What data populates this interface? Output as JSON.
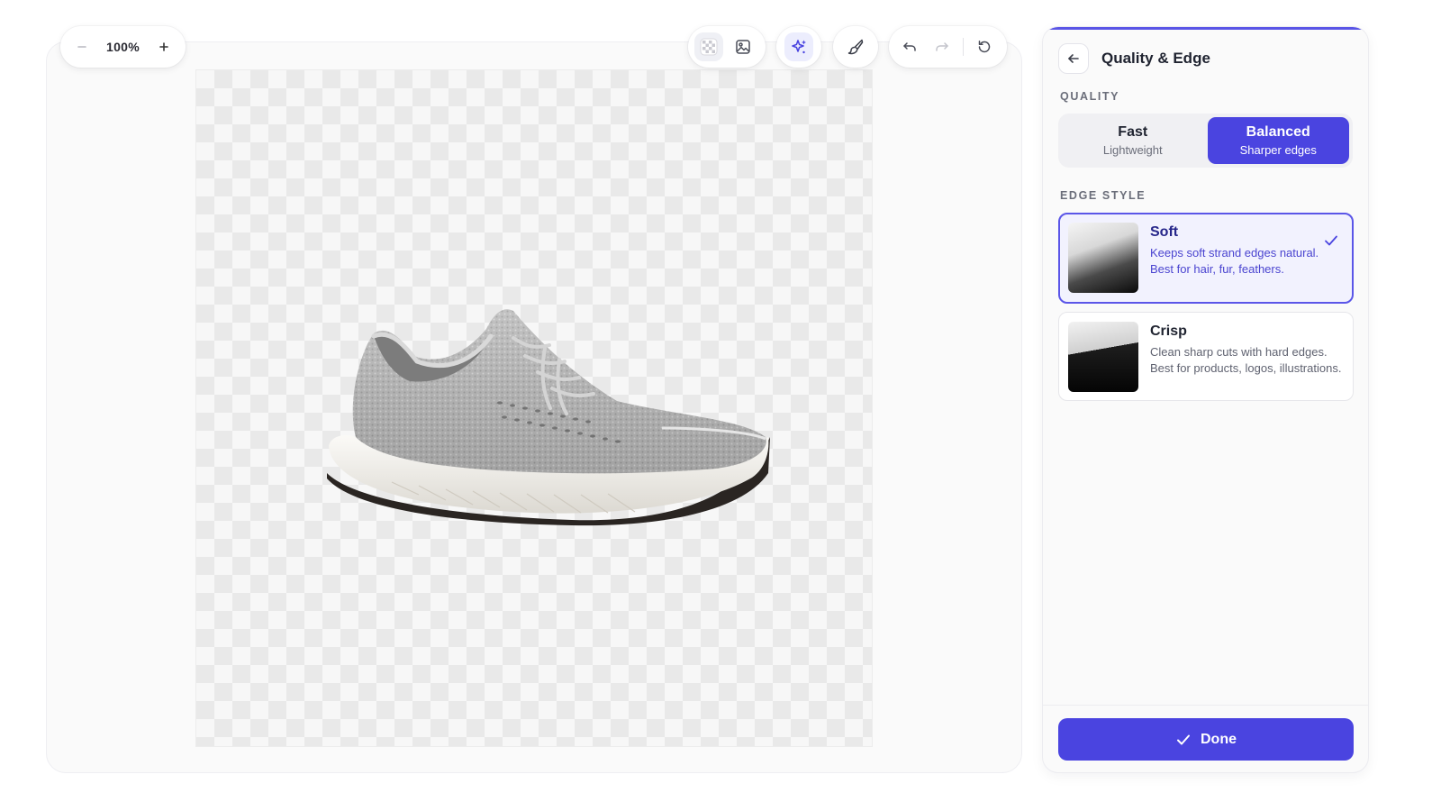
{
  "zoom": {
    "minus_icon": "minus-icon",
    "value": "100%",
    "plus_icon": "plus-icon"
  },
  "toolbar": {
    "icons": [
      "transparent-bg-icon",
      "image-bg-icon",
      "sparkle-icon",
      "brush-icon",
      "undo-icon",
      "redo-icon",
      "reset-icon"
    ]
  },
  "panel": {
    "title": "Quality & Edge",
    "quality_label": "QUALITY",
    "quality_options": [
      {
        "title": "Fast",
        "subtitle": "Lightweight",
        "selected": false
      },
      {
        "title": "Balanced",
        "subtitle": "Sharper edges",
        "selected": true
      }
    ],
    "edge_label": "EDGE STYLE",
    "edge_options": [
      {
        "title": "Soft",
        "description": "Keeps soft strand edges natural. Best for hair, fur, feathers.",
        "selected": true
      },
      {
        "title": "Crisp",
        "description": "Clean sharp cuts with hard edges. Best for products, logos, illustrations.",
        "selected": false
      }
    ],
    "done_label": "Done"
  },
  "colors": {
    "accent": "#4a44e0",
    "selected_card_bg": "#f2f2fe"
  }
}
